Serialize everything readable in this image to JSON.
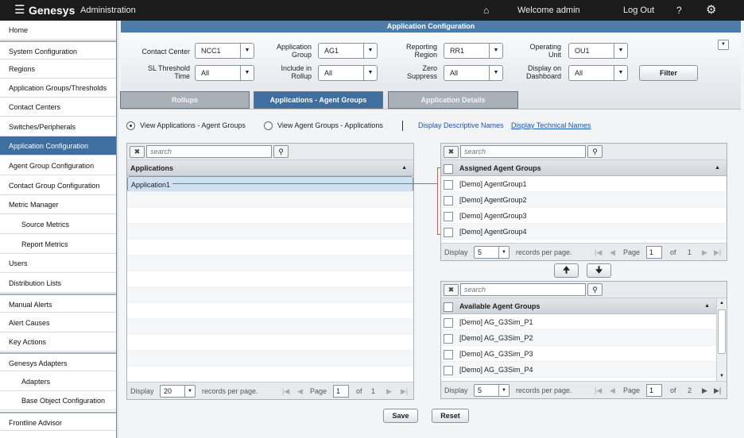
{
  "topbar": {
    "brand": "Genesys",
    "section": "Administration",
    "welcome": "Welcome  admin",
    "logout": "Log Out",
    "help": "?"
  },
  "sidebar": {
    "items": [
      "Home",
      "System Configuration",
      "Regions",
      "Application Groups/Thresholds",
      "Contact Centers",
      "Switches/Peripherals",
      "Application Configuration",
      "Agent Group Configuration",
      "Contact Group Configuration",
      "Metric Manager",
      "Source Metrics",
      "Report Metrics",
      "Users",
      "Distribution Lists",
      "Manual Alerts",
      "Alert Causes",
      "Key Actions",
      "Genesys Adapters",
      "Adapters",
      "Base Object Configuration",
      "Frontline Advisor"
    ],
    "active_index": 6
  },
  "header": {
    "title": "Application Configuration"
  },
  "filters": {
    "contact_center": {
      "label": "Contact Center",
      "value": "NCC1"
    },
    "application_group": {
      "label": "Application Group",
      "value": "AG1"
    },
    "reporting_region": {
      "label": "Reporting Region",
      "value": "RR1"
    },
    "operating_unit": {
      "label": "Operating Unit",
      "value": "OU1"
    },
    "sl_threshold_time": {
      "label": "SL Threshold Time",
      "value": "All"
    },
    "include_in_rollup": {
      "label": "Include in Rollup",
      "value": "All"
    },
    "zero_suppress": {
      "label": "Zero Suppress",
      "value": "All"
    },
    "display_on_dashboard": {
      "label": "Display on Dashboard",
      "value": "All"
    },
    "filter_button": "Filter"
  },
  "tabs": {
    "rollups": "Rollups",
    "agent_groups": "Applications - Agent Groups",
    "details": "Application Details"
  },
  "view": {
    "radio1": "View Applications - Agent Groups",
    "radio2": "View Agent Groups - Applications",
    "link_desc": "Display Descriptive Names",
    "link_tech": "Display Technical Names"
  },
  "applications": {
    "search_placeholder": "search",
    "header": "Applications",
    "rows": [
      "Application1"
    ],
    "pager": {
      "display": "Display",
      "size": "20",
      "records": "records per page.",
      "page": "Page",
      "current": "1",
      "of": "of",
      "total": "1"
    }
  },
  "assigned": {
    "search_placeholder": "search",
    "header": "Assigned Agent Groups",
    "rows": [
      "[Demo] AgentGroup1",
      "[Demo] AgentGroup2",
      "[Demo] AgentGroup3",
      "[Demo] AgentGroup4"
    ],
    "pager": {
      "display": "Display",
      "size": "5",
      "records": "records per page.",
      "page": "Page",
      "current": "1",
      "of": "of",
      "total": "1"
    }
  },
  "available": {
    "search_placeholder": "search",
    "header": "Available Agent Groups",
    "rows": [
      "[Demo] AG_G3Sim_P1",
      "[Demo] AG_G3Sim_P2",
      "[Demo] AG_G3Sim_P3",
      "[Demo] AG_G3Sim_P4"
    ],
    "pager": {
      "display": "Display",
      "size": "5",
      "records": "records per page.",
      "page": "Page",
      "current": "1",
      "of": "of",
      "total": "2"
    }
  },
  "actions": {
    "save": "Save",
    "reset": "Reset"
  }
}
